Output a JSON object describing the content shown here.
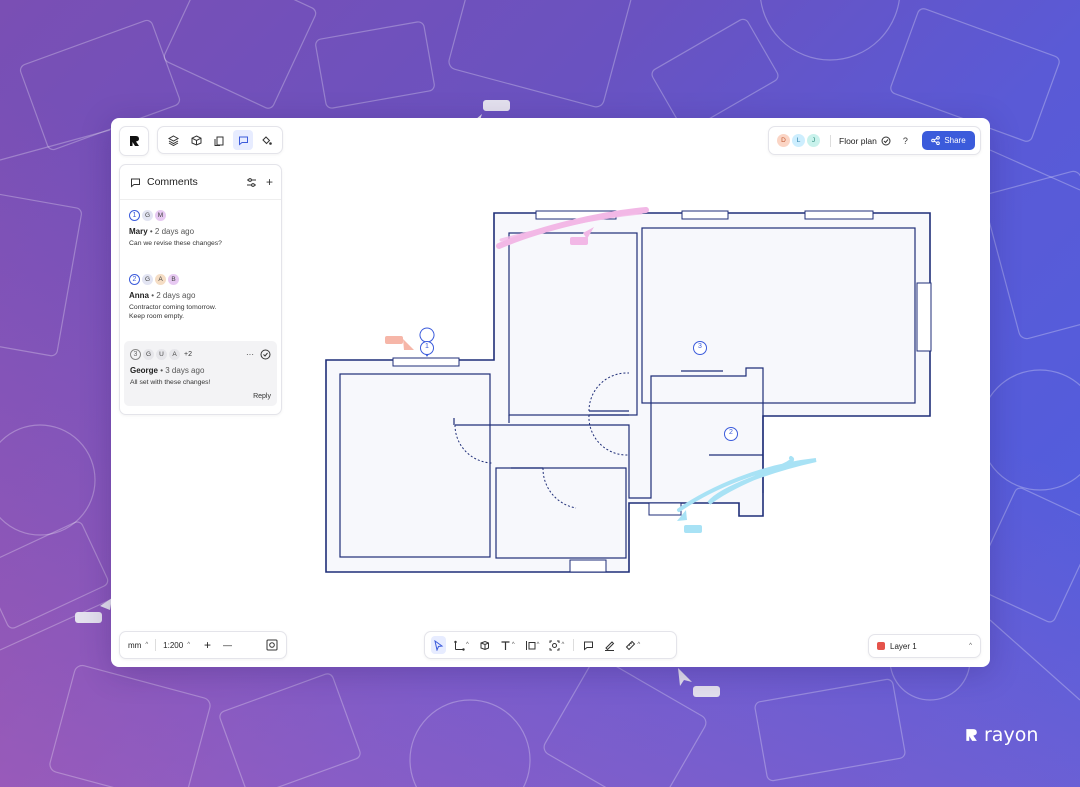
{
  "app": {
    "title": "Floor plan",
    "brand": "rayon",
    "accent": "#3b5bdb"
  },
  "header": {
    "avatars": [
      {
        "initial": "D",
        "color": "#fbd5c5",
        "text_color": "#c0552d"
      },
      {
        "initial": "L",
        "color": "#cdeefe",
        "text_color": "#2a7fa8"
      },
      {
        "initial": "J",
        "color": "#c9f2ec",
        "text_color": "#2a8a7a"
      }
    ],
    "title": "Floor plan",
    "help": "?",
    "share_label": "Share"
  },
  "comments": {
    "title": "Comments",
    "items": [
      {
        "number": "1",
        "avatars": [
          "G",
          "M"
        ],
        "author": "Mary",
        "time": " • 2 days ago",
        "text": "Can we revise these changes?"
      },
      {
        "number": "2",
        "avatars": [
          "G",
          "A",
          "B"
        ],
        "author": "Anna",
        "time": " • 2 days ago",
        "text": "Contractor coming tomorrow.\nKeep room empty."
      },
      {
        "number": "3",
        "avatars": [
          "G",
          "U",
          "A"
        ],
        "extra": "+2",
        "author": "George",
        "time": " • 3 days ago",
        "text": "All set with these changes!",
        "reply_label": "Reply"
      }
    ]
  },
  "bottom": {
    "unit": "mm",
    "scale": "1:200",
    "zoom_in": "+",
    "zoom_out": "—"
  },
  "layer": {
    "name": "Layer 1",
    "color": "#e5534b"
  },
  "markers": [
    "1",
    "3",
    "2"
  ],
  "cursors": [
    {
      "color": "#f6b6a8"
    },
    {
      "color": "#f2b8e6"
    },
    {
      "color": "#a8e2f5"
    },
    {
      "color": "#e4e1ee"
    }
  ]
}
